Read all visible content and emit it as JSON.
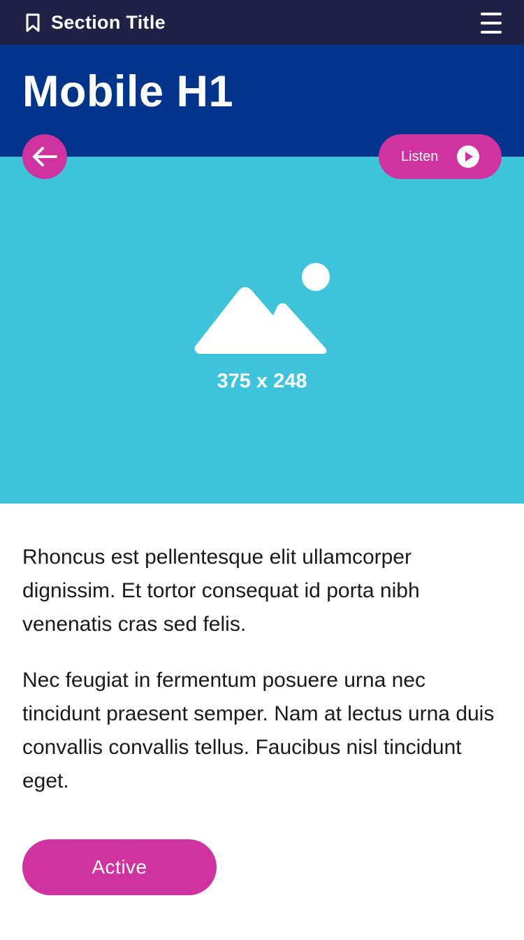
{
  "topbar": {
    "section_title": "Section Title",
    "bookmark_icon": "bookmark-icon",
    "menu_icon": "hamburger-menu-icon"
  },
  "header": {
    "title": "Mobile H1"
  },
  "hero": {
    "placeholder_icon": "image-placeholder-icon",
    "placeholder_label": "375 x 248"
  },
  "actions": {
    "back_icon": "arrow-left-icon",
    "listen_label": "Listen",
    "play_icon": "play-circle-icon"
  },
  "content": {
    "paragraphs": [
      "Rhoncus est pellentesque elit ullamcorper dignissim. Et tortor consequat id porta nibh venenatis cras sed felis.",
      "Nec feugiat in fermentum posuere urna nec tincidunt praesent semper. Nam at lectus urna duis convallis convallis tellus. Faucibus nisl tincidunt eget."
    ]
  },
  "footer": {
    "active_label": "Active"
  },
  "colors": {
    "topbar_bg": "#212047",
    "header_bg": "#02348b",
    "hero_bg": "#3dc4da",
    "accent": "#d0329f",
    "text": "#1a1a1a"
  }
}
